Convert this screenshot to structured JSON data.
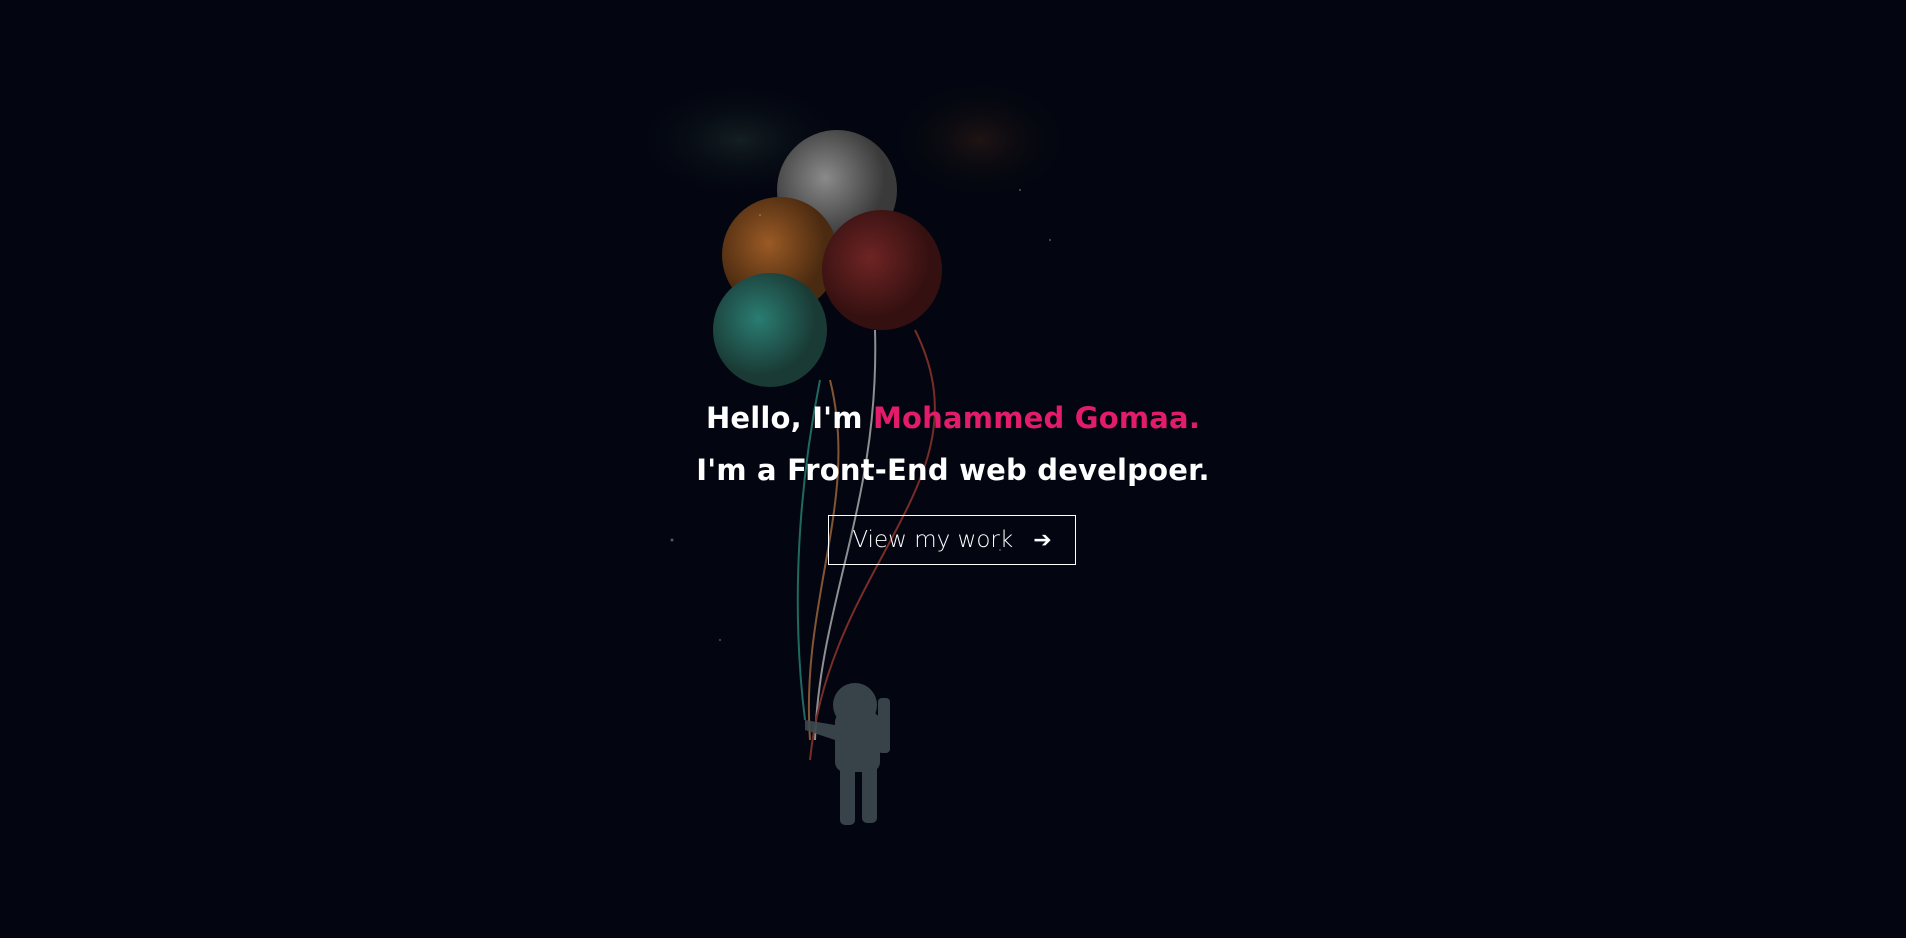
{
  "hero": {
    "greeting": "Hello, I'm ",
    "name": "Mohammed Gomaa.",
    "tagline": "I'm a Front-End web develpoer.",
    "cta_label": "View my work",
    "cta_icon": "arrow-right-icon"
  },
  "colors": {
    "accent": "#e31b6d",
    "background": "#030610"
  }
}
